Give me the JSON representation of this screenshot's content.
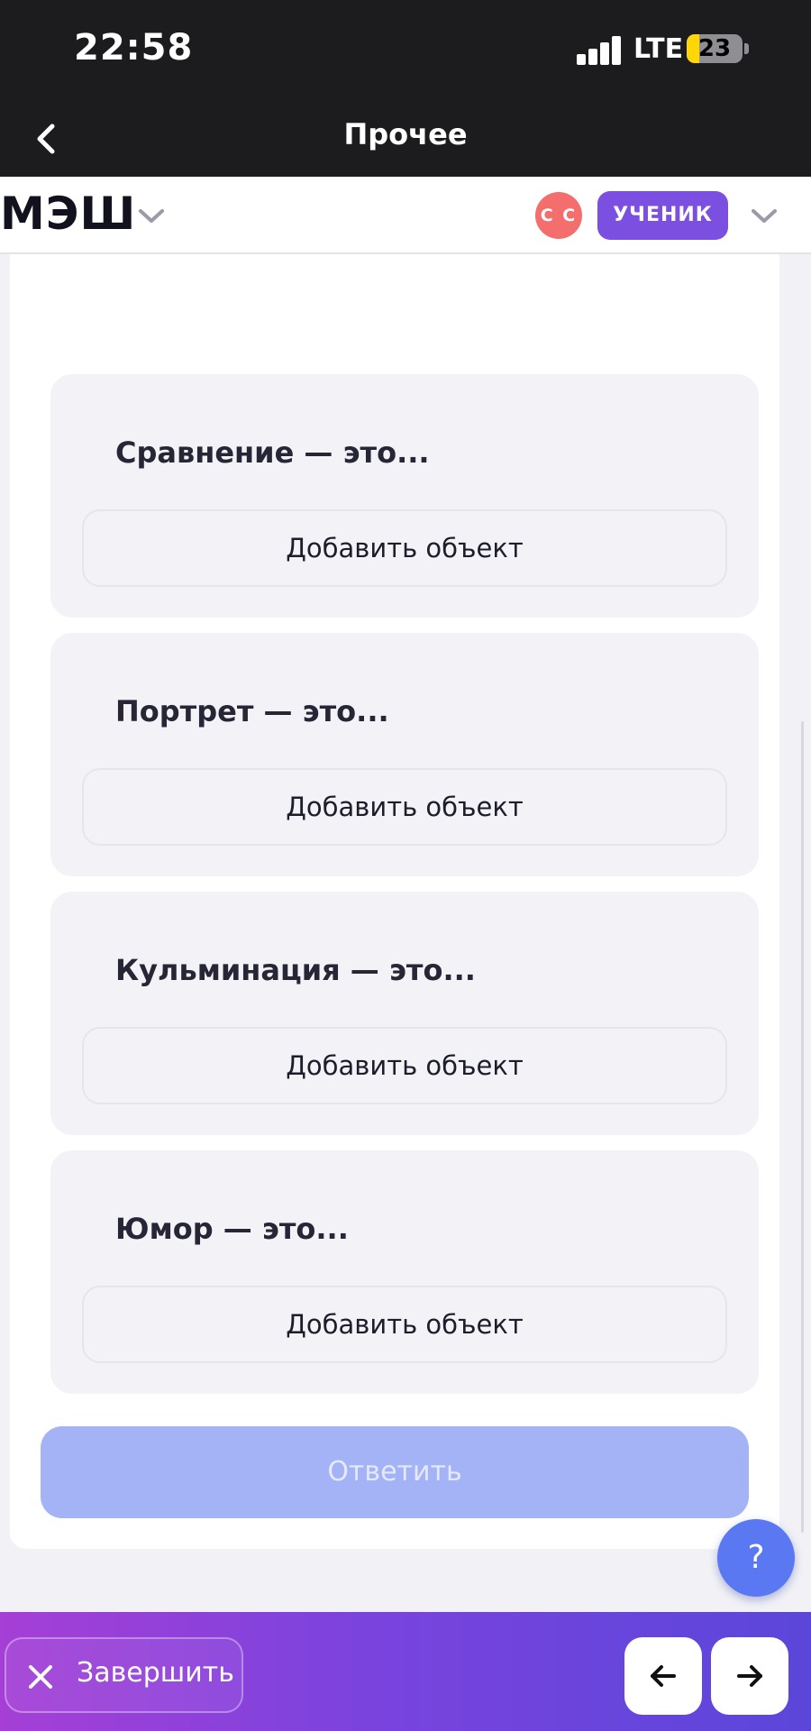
{
  "status_bar": {
    "time": "22:58",
    "network": "LTE",
    "battery_level": "23",
    "battery_fraction": 0.23,
    "signal_icon": "signal-bars-icon",
    "battery_icon": "battery-charging-icon"
  },
  "nav": {
    "title": "Прочее",
    "back_icon": "chevron-left-icon"
  },
  "app_header": {
    "logo": "МЭШ",
    "avatar_initials": "С С",
    "role": "УЧЕНИК",
    "avatar_color": "#f46e6e",
    "role_color": "#7b4fe0"
  },
  "questions": [
    {
      "label": "Сравнение — это...",
      "button": "Добавить объект"
    },
    {
      "label": "Портрет — это...",
      "button": "Добавить объект"
    },
    {
      "label": "Кульминация — это...",
      "button": "Добавить объект"
    },
    {
      "label": "Юмор — это...",
      "button": "Добавить объект"
    }
  ],
  "submit_label": "Ответить",
  "help_label": "?",
  "bottom_bar": {
    "finish_label": "Завершить",
    "finish_icon": "close-icon",
    "prev_icon": "arrow-left-icon",
    "next_icon": "arrow-right-icon"
  },
  "colors": {
    "accent": "#7b4fe0",
    "submit_disabled": "#a4b3f6",
    "help": "#5b78f3"
  }
}
